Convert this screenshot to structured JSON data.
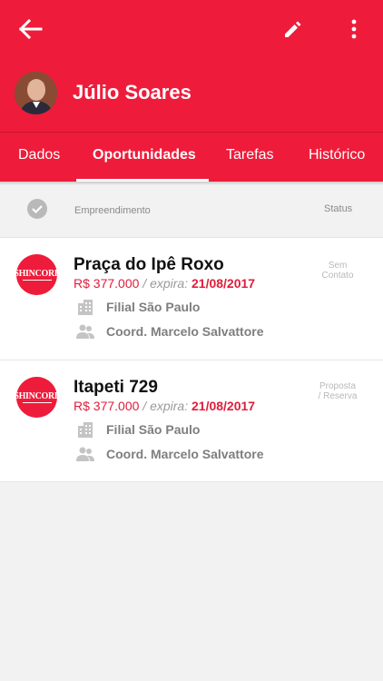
{
  "header": {
    "name": "Júlio Soares",
    "back_icon": "arrow-back-icon",
    "edit_icon": "pencil-icon",
    "more_icon": "more-vert-icon"
  },
  "tabs": [
    {
      "label": "Dados"
    },
    {
      "label": "Oportunidades",
      "active": true
    },
    {
      "label": "Tarefas"
    },
    {
      "label": "Histórico"
    }
  ],
  "columns": {
    "empreendimento": "Empreendimento",
    "status": "Status"
  },
  "opportunities": [
    {
      "logo_text": "SHINCORP",
      "title": "Praça do Ipê Roxo",
      "price": "R$ 377.000",
      "expira_label": "/ expira:",
      "expira_date": "21/08/2017",
      "filial": "Filial São Paulo",
      "coord": "Coord. Marcelo Salvattore",
      "status_line1": "Sem",
      "status_line2": "Contato"
    },
    {
      "logo_text": "SHINCORP",
      "title": "Itapeti 729",
      "price": "R$ 377.000",
      "expira_label": "/ expira:",
      "expira_date": "21/08/2017",
      "filial": "Filial São Paulo",
      "coord": "Coord. Marcelo Salvattore",
      "status_line1": "Proposta",
      "status_line2": "/ Reserva"
    }
  ],
  "colors": {
    "primary": "#ee1c3a",
    "price": "#e01d3a",
    "muted": "#7e7e7e"
  }
}
